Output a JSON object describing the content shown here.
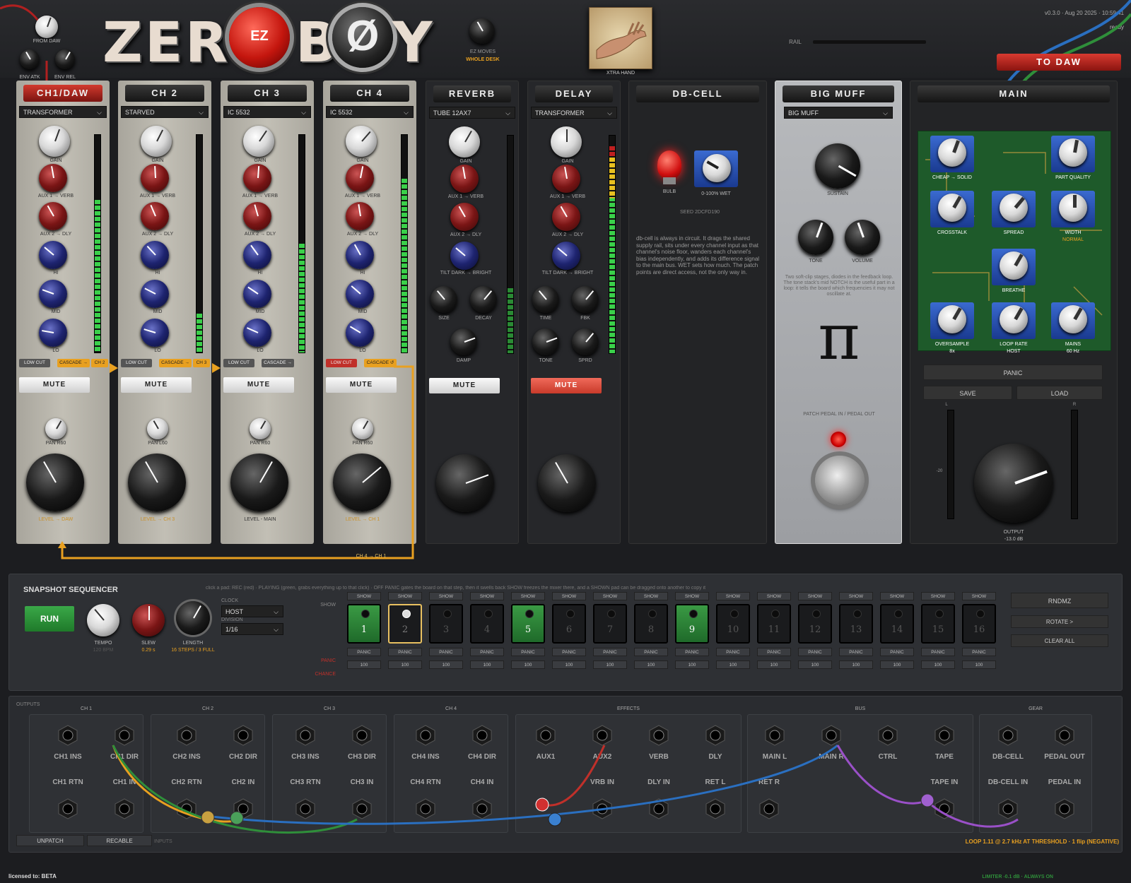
{
  "header": {
    "logo": {
      "z": "Z",
      "e": "E",
      "r": "R",
      "ez": "EZ",
      "b": "B",
      "o": "Ø",
      "y": "Y"
    },
    "knob_labels": {
      "from_daw": "FROM DAW",
      "env_atk": "ENV ATK",
      "env_rel": "ENV REL",
      "ez_moves": "EZ MOVES",
      "whole_desk": "WHOLE DESK",
      "xtra_hand": "XTRA HAND",
      "rail": "RAIL"
    },
    "version": "v0.3.0 · Aug 20 2025 · 10:59:41",
    "status": "ready",
    "to_daw": "TO DAW"
  },
  "channels": [
    {
      "title": "CH1/DAW",
      "model": "TRANSFORMER",
      "labels": [
        "GAIN",
        "AUX 1 → VERB",
        "AUX 2 → DLY",
        "HI",
        "MID",
        "LO"
      ],
      "low_cut": "LOW CUT",
      "cascade": "CASCADE →",
      "cascade_to": "CH 2",
      "mute": "MUTE",
      "pan": "PAN R60",
      "fader": "LEVEL → DAW"
    },
    {
      "title": "CH 2",
      "model": "STARVED",
      "labels": [
        "GAIN",
        "AUX 1 → VERB",
        "AUX 2 → DLY",
        "HI",
        "MID",
        "LO"
      ],
      "low_cut": "LOW CUT",
      "cascade": "CASCADE →",
      "cascade_to": "CH 3",
      "mute": "MUTE",
      "pan": "PAN L60",
      "fader": "LEVEL → CH 3"
    },
    {
      "title": "CH 3",
      "model": "IC 5532",
      "labels": [
        "GAIN",
        "AUX 1 → VERB",
        "AUX 2 → DLY",
        "HI",
        "MID",
        "LO"
      ],
      "low_cut": "LOW CUT",
      "cascade": "CASCADE →",
      "mute": "MUTE",
      "pan": "PAN R60",
      "fader": "LEVEL - MAIN"
    },
    {
      "title": "CH 4",
      "model": "IC 5532",
      "labels": [
        "GAIN",
        "AUX 1 → VERB",
        "AUX 2 → DLY",
        "HI",
        "MID",
        "LO"
      ],
      "low_cut": "LOW CUT",
      "cascade": "CASCADE ↺",
      "mute": "MUTE",
      "pan": "PAN R60",
      "fader": "LEVEL → CH 1"
    }
  ],
  "reverb": {
    "title": "REVERB",
    "model": "TUBE 12AX7",
    "labels": [
      "GAIN",
      "AUX 1 → VERB",
      "AUX 2 → DLY",
      "TILT DARK → BRIGHT",
      "SIZE",
      "DECAY",
      "DAMP"
    ],
    "mute": "MUTE"
  },
  "delay": {
    "title": "DELAY",
    "model": "TRANSFORMER",
    "labels": [
      "GAIN",
      "AUX 1 → VERB",
      "AUX 2 → DLY",
      "TILT DARK → BRIGHT",
      "TIME",
      "FBK",
      "TONE",
      "SPRD"
    ],
    "mute": "MUTE"
  },
  "cascade_return": "CH 4 → CH 1",
  "dbcell": {
    "title": "DB-CELL",
    "bulb": "BULB",
    "wet": "0-100% WET",
    "seed": "SEED 2DCFD190",
    "desc": "db-cell is always in circuit. It drags the shared supply rail, sits under every channel input as that channel's noise floor, wanders each channel's bias independently, and adds its difference signal to the main bus. WET sets how much. The patch points are direct access, not the only way in."
  },
  "bigmuff": {
    "title": "BIG MUFF",
    "model": "BIG MUFF",
    "sustain": "SUSTAIN",
    "tone": "TONE",
    "volume": "VOLUME",
    "desc": "Two soft-clip stages, diodes in the feedback loop. The tone stack's mid NOTCH is the useful part in a loop: it tells the board which frequencies it may not oscillate at.",
    "pi": "π",
    "pedal": "PATCH PEDAL IN / PEDAL OUT"
  },
  "main": {
    "title": "MAIN",
    "knobs": [
      "CHEAP → SOLID",
      "PART QUALITY",
      "CROSSTALK",
      "SPREAD",
      "WIDTH",
      "BREATHE",
      "OVERSAMPLE",
      "LOOP RATE",
      "MAINS"
    ],
    "width_sub": "NORMAL",
    "oversample_sub": "8x",
    "looprate_sub": "HOST",
    "mains_sub": "60 Hz",
    "panic": "PANIC",
    "save": "SAVE",
    "load": "LOAD",
    "output": "OUTPUT",
    "output_val": "-13.0 dB",
    "meter_l": "L",
    "meter_r": "R",
    "meter_tick": "-20"
  },
  "sequencer": {
    "title": "SNAPSHOT SEQUENCER",
    "hint": "click a pad: REC (red) · PLAYING (green, grabs everything up to that click) · OFF   PANIC gates the board on that step, then it swells back   SHOW freezes the mixer there, and a SHOWN pad can be dragged onto another to copy it",
    "run": "RUN",
    "tempo": "TEMPO",
    "tempo_sub": "120 BPM",
    "slew": "SLEW",
    "slew_val": "0.29 s",
    "length": "LENGTH",
    "length_val": "16 STEPS / 3 FULL",
    "clock_label": "CLOCK",
    "clock": "HOST",
    "division_label": "DIVISION",
    "division": "1/16",
    "show": "SHOW",
    "panic": "PANIC",
    "chance": "CHANCE",
    "steps": [
      {
        "n": "1",
        "state": "green"
      },
      {
        "n": "2",
        "state": "selected"
      },
      {
        "n": "3",
        "state": "off"
      },
      {
        "n": "4",
        "state": "off"
      },
      {
        "n": "5",
        "state": "green"
      },
      {
        "n": "6",
        "state": "off"
      },
      {
        "n": "7",
        "state": "off"
      },
      {
        "n": "8",
        "state": "off"
      },
      {
        "n": "9",
        "state": "green"
      },
      {
        "n": "10",
        "state": "off"
      },
      {
        "n": "11",
        "state": "off"
      },
      {
        "n": "12",
        "state": "off"
      },
      {
        "n": "13",
        "state": "off"
      },
      {
        "n": "14",
        "state": "off"
      },
      {
        "n": "15",
        "state": "off"
      },
      {
        "n": "16",
        "state": "off"
      }
    ],
    "chance_val": "100",
    "rndmz": "RNDMZ",
    "rotate": "ROTATE >",
    "clear": "CLEAR ALL"
  },
  "patchbay": {
    "outputs": "OUTPUTS",
    "inputs": "INPUTS",
    "groups": [
      "CH 1",
      "CH 2",
      "CH 3",
      "CH 4",
      "EFFECTS",
      "BUS",
      "GEAR"
    ],
    "top": [
      "CH1 INS",
      "CH1 DIR",
      "CH2 INS",
      "CH2 DIR",
      "CH3 INS",
      "CH3 DIR",
      "CH4 INS",
      "CH4 DIR",
      "AUX1",
      "AUX2",
      "VERB",
      "DLY",
      "MAIN L",
      "MAIN R",
      "CTRL",
      "TAPE",
      "DB-CELL",
      "PEDAL OUT"
    ],
    "bottom": [
      "CH1 RTN",
      "CH1 IN",
      "CH2 RTN",
      "CH2 IN",
      "CH3 RTN",
      "CH3 IN",
      "CH4 RTN",
      "CH4 IN",
      "VRB IN",
      "DLY IN",
      "RET L",
      "RET R",
      "TAPE IN",
      "DB-CELL IN",
      "PEDAL IN"
    ],
    "unpatch": "UNPATCH",
    "recable": "RECABLE",
    "status": "LOOP 1.11 @ 2.7 kHz  AT THRESHOLD · 1 flip (NEGATIVE)",
    "limiter": "LIMITER -0.1 dB · ALWAYS ON"
  },
  "footer": {
    "license": "licensed to: BETA"
  },
  "colors": {
    "orange": "#e8a020",
    "green": "#2f8f3a",
    "red": "#c0302a",
    "blue": "#2a6fc0",
    "purple": "#9a50c8"
  }
}
